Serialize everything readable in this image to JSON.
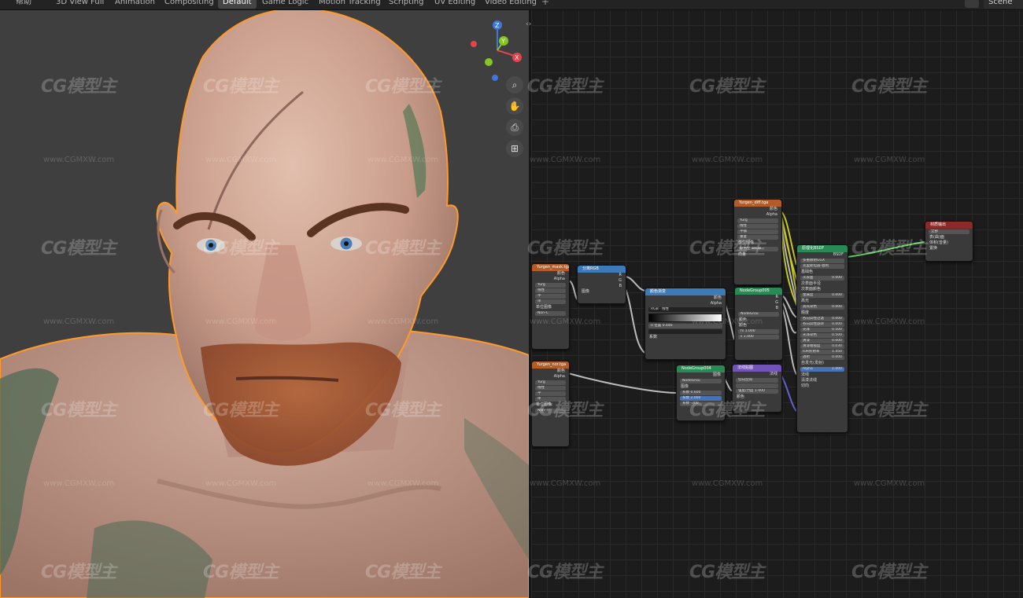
{
  "top_tabs": [
    "3D View Full",
    "Animation",
    "Compositing",
    "Default",
    "Game Logic",
    "Motion Tracking",
    "Scripting",
    "UV Editing",
    "Video Editing"
  ],
  "active_tab": "Default",
  "cut_tab": "帮助",
  "scene_label": "Scene",
  "colors": {
    "selection_outline": "#ff9a2a",
    "axis_x": "#e8434d",
    "axis_y": "#85c624",
    "axis_z": "#3f78d8",
    "header_image": "#b35c28",
    "header_converter": "#3d7ab8",
    "header_group": "#2a8a55",
    "header_output": "#8c2a2a",
    "header_shader": "#7253b8"
  },
  "gizmo": {
    "x": "X",
    "y": "Y",
    "z": "Z"
  },
  "nav_icons": [
    "zoom-icon",
    "hand-icon",
    "camera-icon",
    "grid-icon"
  ],
  "watermark": {
    "logo": "CG模型主",
    "url": "www.CGMXW.com"
  },
  "nodes": {
    "img1": {
      "title": "Yurgen_mask.tga",
      "out1": "颜色",
      "out2": "Alpha",
      "field1": "Yurg",
      "field2": "线性",
      "field3": "平",
      "field4": "单",
      "field5": "单位图像",
      "field6": "颜色空",
      "field6val": "Non-C"
    },
    "sep": {
      "title": "分离RGB",
      "in1": "图像",
      "out1": "R",
      "out2": "G",
      "out3": "B"
    },
    "ramp": {
      "title": "颜色渐变",
      "out1": "颜色",
      "out2": "Alpha",
      "mode1": "RGB",
      "mode2": "线性",
      "pos_label": "0",
      "pos_val": "位置",
      "pos_num": "0.446",
      "in1": "系数"
    },
    "img2": {
      "title": "Yurgen_diff.tga",
      "out1": "颜色",
      "out2": "Alpha",
      "field1": "Yurg",
      "field2": "线性",
      "field3": "平铺",
      "field4": "重复",
      "field5": "单位图像",
      "field6": "颜色空",
      "field6val": "sRGB",
      "field7": "向量"
    },
    "grp5": {
      "title": "NodeGroup005",
      "out1": "R",
      "out2": "G",
      "out3": "B",
      "field1": "NodeGrou",
      "in1": "颜色",
      "in2": "颜色",
      "in3": "fx",
      "in3val": "1.000",
      "in4": "s",
      "in4val": "1.000"
    },
    "img3": {
      "title": "Yurgen_nor.tga",
      "out1": "颜色",
      "out2": "Alpha",
      "field1": "Yurg",
      "field2": "线性",
      "field3": "平",
      "field4": "单",
      "field5": "单位图像",
      "field6": "颜色空",
      "field6val": "Non-"
    },
    "grp4": {
      "title": "NodeGroup004",
      "out1": "图像",
      "field1": "NodeGrou",
      "in1": "图像",
      "in2": "系数",
      "in2val": "0.600",
      "in3": "系数",
      "in3val": "2.000",
      "in4": "系数",
      "in4val": "-300"
    },
    "normal": {
      "title": "法线贴图",
      "out1": "法线",
      "mode": "切向空间",
      "in1": "强度/力度",
      "in1val": "1.000",
      "in2": "颜色"
    },
    "bsdf": {
      "title": "原理化BSDF",
      "out1": "BSDF",
      "mode1": "多重散射GGX",
      "mode2": "克里斯坦森-伯利",
      "rows": [
        "基础色",
        "次表面",
        "次表面半径",
        "次表面颜色",
        "金属度",
        "高光",
        "高光染色",
        "糙度",
        "各向异性过滤",
        "各向异性旋转",
        "光泽",
        "光泽染色",
        "清漆",
        "清漆粗糙度",
        "IOR折射率",
        "透射",
        "自发光(发射)",
        "Alpha",
        "法线",
        "清漆法线",
        "切向"
      ],
      "vals": [
        "",
        "0.000",
        "",
        "",
        "0.000",
        "",
        "0.000",
        "",
        "0.000",
        "0.000",
        "0.500",
        "0.500",
        "0.000",
        "0.030",
        "1.450",
        "0.000",
        "",
        "1.000",
        "",
        "",
        ""
      ]
    },
    "output": {
      "title": "材质输出",
      "mode": "全部",
      "in1": "表(曲)面",
      "in2": "体积(音量)",
      "in3": "置换"
    }
  }
}
